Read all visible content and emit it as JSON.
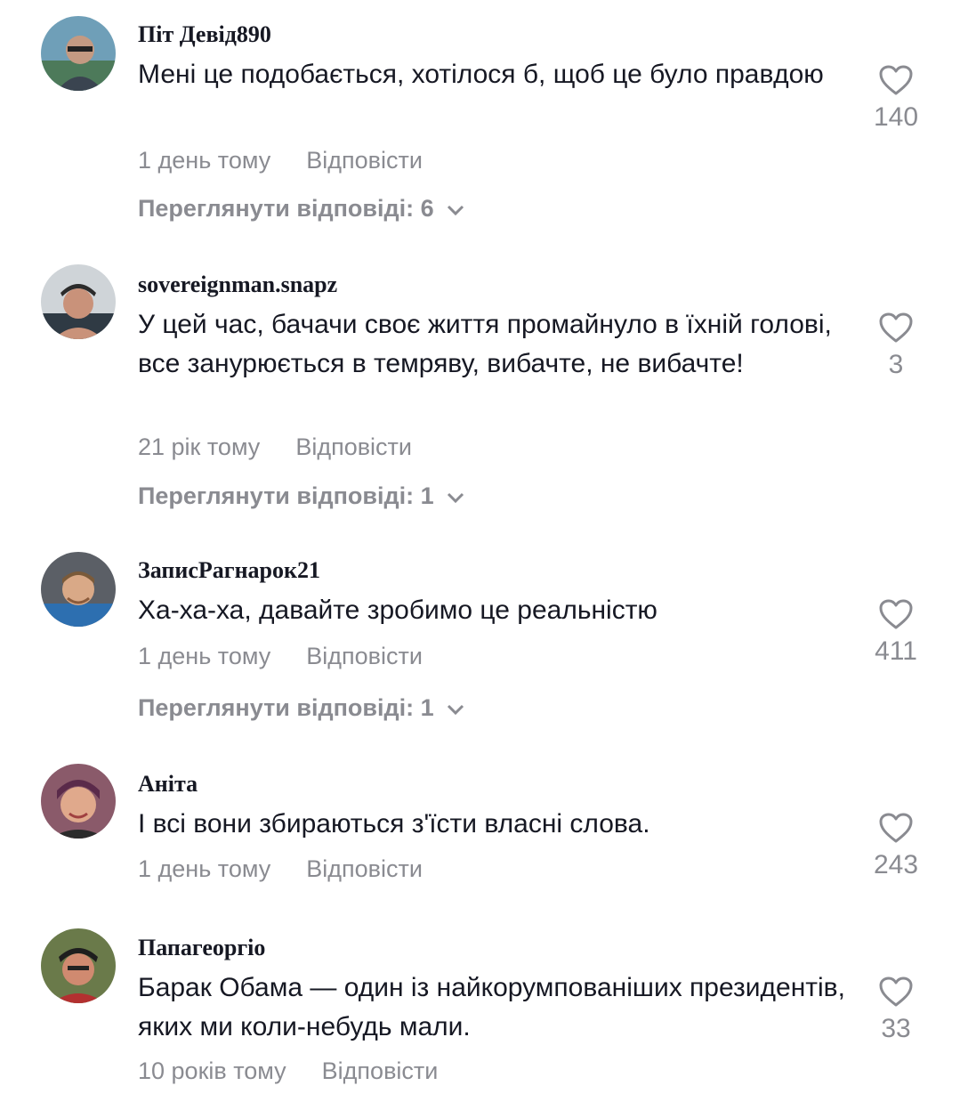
{
  "comments": [
    {
      "username": "Піт Девід890",
      "text": "Мені це подобається, хотілося б, щоб це було правдою",
      "time": "1 день тому",
      "reply_label": "Відповісти",
      "view_replies": "Переглянути відповіді: 6",
      "likes": "140"
    },
    {
      "username": "sovereignman.snapz",
      "text": "У цей час, бачачи своє життя промайнуло в їхній голові, все занурюється в темряву, вибачте, не вибачте!",
      "time": "21 рік тому",
      "reply_label": "Відповісти",
      "view_replies": "Переглянути відповіді: 1",
      "likes": "3"
    },
    {
      "username": "ЗаписРагнарок21",
      "text": "Ха-ха-ха, давайте зробимо це реальністю",
      "time": "1 день тому",
      "reply_label": "Відповісти",
      "view_replies": "Переглянути відповіді: 1",
      "likes": "411"
    },
    {
      "username": "Аніта",
      "text": "І всі вони збираються з'їсти власні слова.",
      "time": "1 день тому",
      "reply_label": "Відповісти",
      "likes": "243"
    },
    {
      "username": "Папагеоргіо",
      "text": "Барак Обама — один із найкорумпованіших президентів, яких ми коли-небудь мали.",
      "time": "10 років тому",
      "reply_label": "Відповісти",
      "likes": "33"
    }
  ],
  "colors": {
    "text": "#161823",
    "muted": "#8a8b91",
    "background": "#ffffff"
  },
  "icons": {
    "like": "heart-outline-icon",
    "expand": "chevron-down-icon"
  }
}
